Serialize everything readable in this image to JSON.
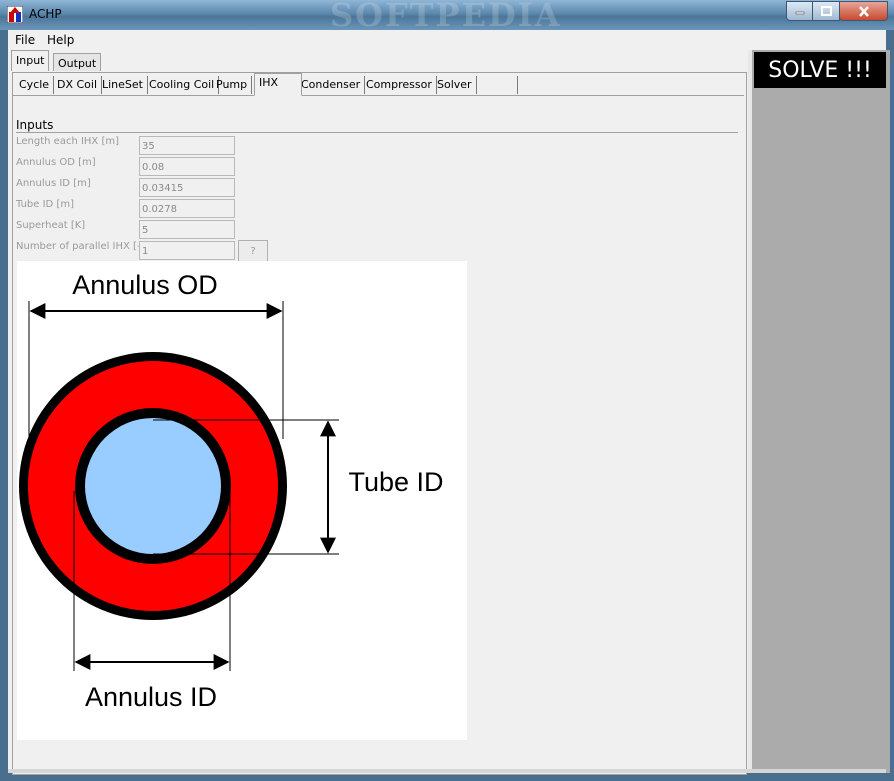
{
  "window": {
    "title": "ACHP",
    "watermark": "SOFTPEDIA"
  },
  "menu": {
    "file": "File",
    "help": "Help"
  },
  "outer_tabs": {
    "input": "Input",
    "output": "Output"
  },
  "inner_tabs": [
    "Cycle",
    "DX Coil",
    "LineSet",
    "Cooling Coil",
    "Pump",
    "IHX",
    "Condenser",
    "Compressor",
    "Solver",
    ""
  ],
  "inputs": {
    "heading": "Inputs",
    "fields": [
      {
        "label": "Length each IHX [m]",
        "value": "35"
      },
      {
        "label": "Annulus OD [m]",
        "value": "0.08"
      },
      {
        "label": "Annulus ID [m]",
        "value": "0.03415"
      },
      {
        "label": "Tube ID [m]",
        "value": "0.0278"
      },
      {
        "label": "Superheat [K]",
        "value": "5"
      },
      {
        "label": "Number of parallel IHX [-]",
        "value": "1"
      }
    ],
    "help_label": "?"
  },
  "diagram": {
    "annulus_od_label": "Annulus OD",
    "tube_id_label": "Tube ID",
    "annulus_id_label": "Annulus ID",
    "colors": {
      "annulus": "#ff0000",
      "tube": "#99ccff",
      "wall": "#000000"
    }
  },
  "solve_button": "SOLVE !!!"
}
